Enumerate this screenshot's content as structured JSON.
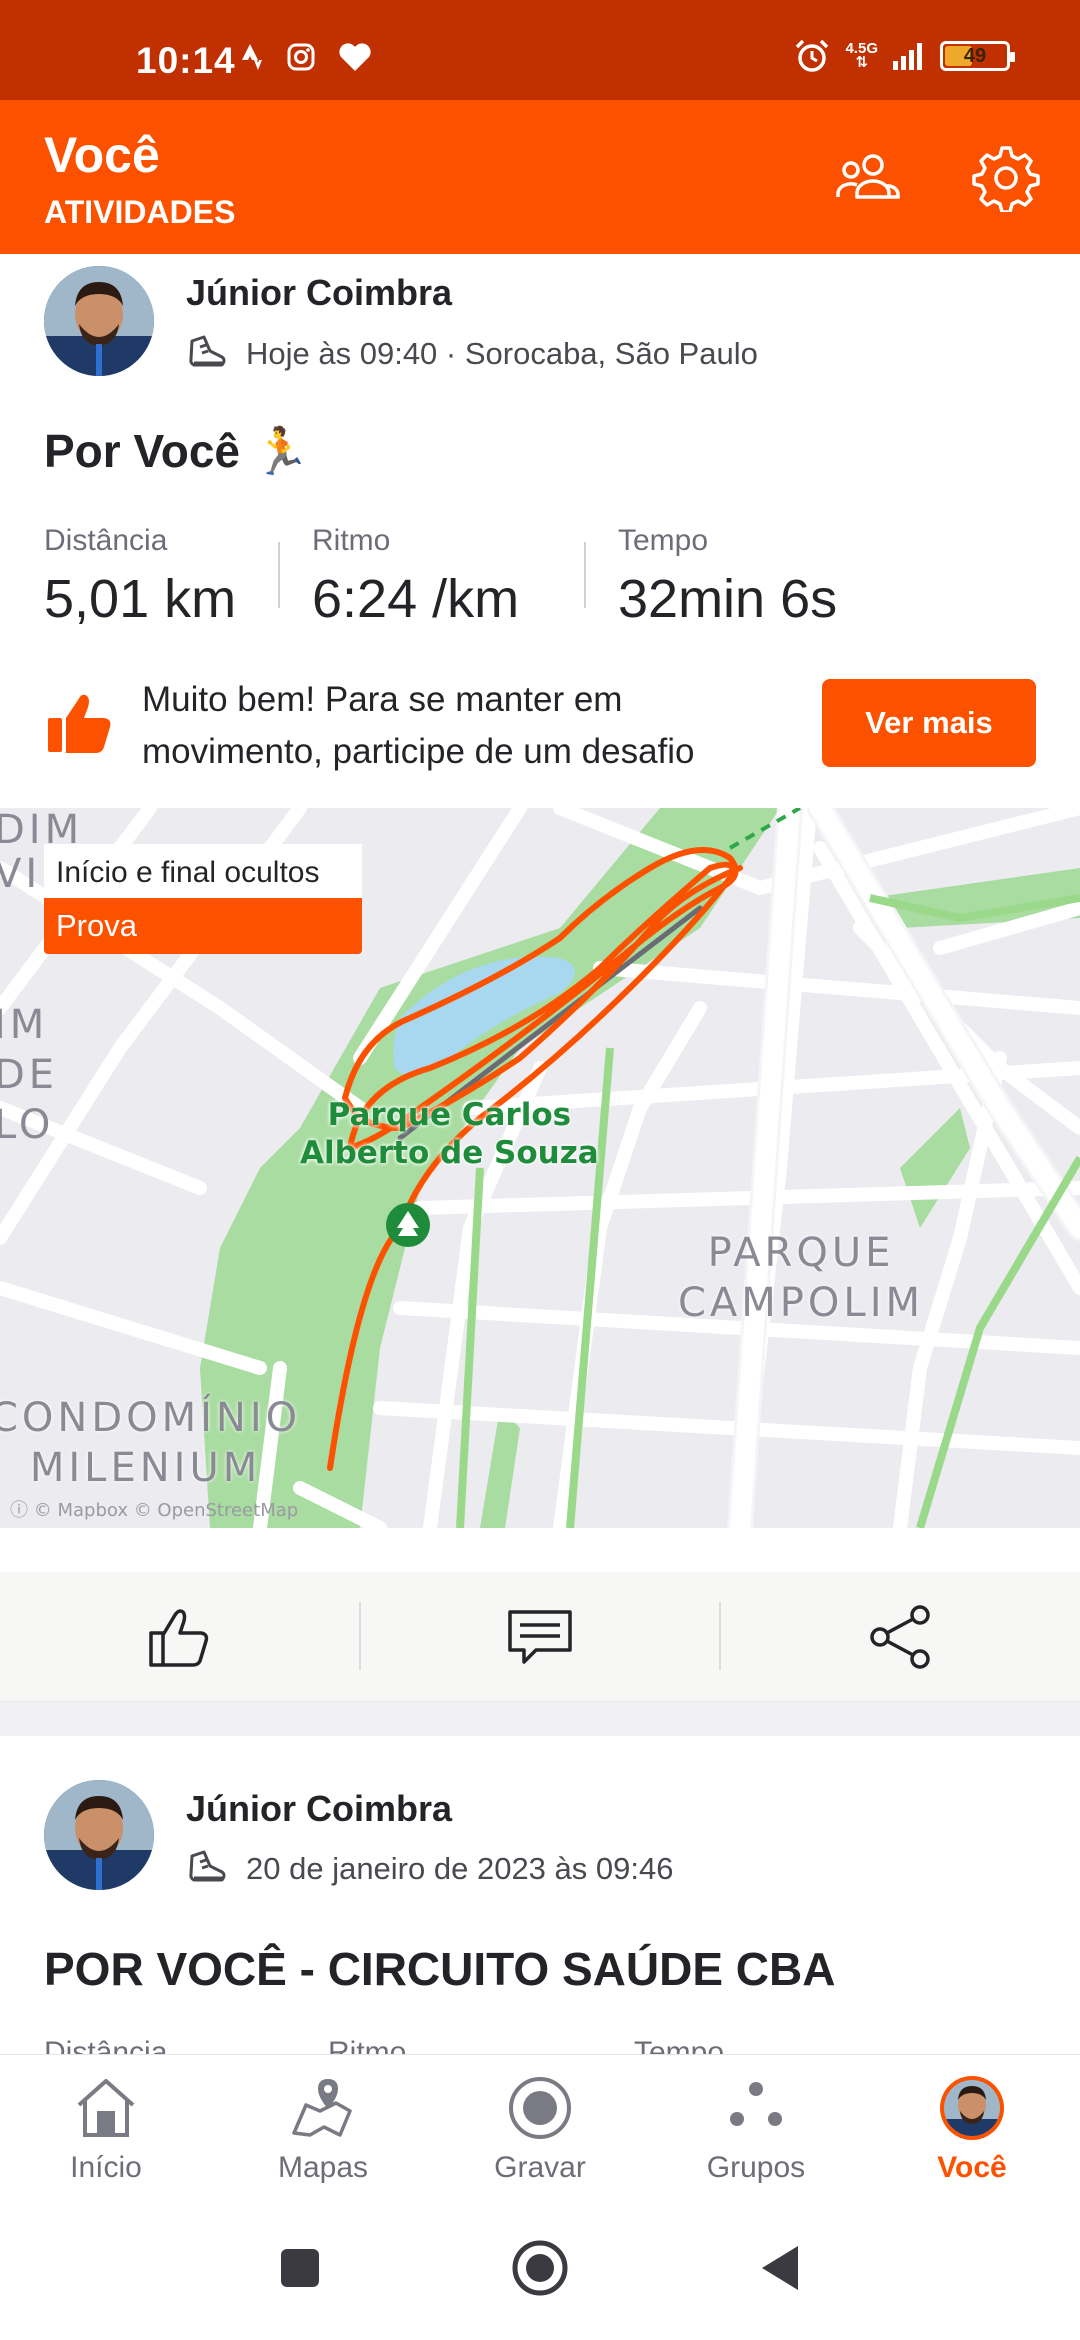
{
  "status_bar": {
    "time": "10:14",
    "network": "4.5G",
    "battery": "49",
    "battery_level": 0.49
  },
  "header": {
    "title": "Você",
    "subtitle": "ATIVIDADES"
  },
  "activity1": {
    "athlete": "Júnior Coimbra",
    "meta": "Hoje às 09:40 · Sorocaba, São Paulo",
    "title": "Por Você 🏃",
    "stats": [
      {
        "label": "Distância",
        "value": "5,01 km"
      },
      {
        "label": "Ritmo",
        "value": "6:24 /km"
      },
      {
        "label": "Tempo",
        "value": "32min 6s"
      }
    ],
    "suggestion": "Muito bem! Para se manter em movimento, participe de um desafio",
    "cta": "Ver mais"
  },
  "map": {
    "hidden_note": "Início e final ocultos",
    "tag": "Prova",
    "labels": {
      "park": "Parque Carlos Alberto de Souza",
      "park_l1": "Parque Carlos",
      "park_l2": "Alberto de Souza",
      "district1_l1": "PARQUE",
      "district1_l2": "CAMPOLIM",
      "district2_l1": "CONDOMÍNIO",
      "district2_l2": "MILENIUM",
      "left_a": "DIM",
      "left_b": "VI",
      "left_c": "IM",
      "left_d": "DE",
      "left_e": "LO"
    },
    "attribution": "© Mapbox © OpenStreetMap",
    "colors": {
      "route": "#fc5200",
      "park": "#a8dca0",
      "water": "#a8d8f0"
    }
  },
  "actions": {
    "like": "thumbs-up-icon",
    "comment": "comment-icon",
    "share": "share-icon"
  },
  "activity2": {
    "athlete": "Júnior Coimbra",
    "meta": "20 de janeiro de 2023 às 09:46",
    "title": "POR VOCÊ - CIRCUITO SAÚDE CBA",
    "stat_labels": [
      "Distância",
      "Ritmo",
      "Tempo"
    ]
  },
  "nav": {
    "items": [
      {
        "label": "Início",
        "icon": "home-icon"
      },
      {
        "label": "Mapas",
        "icon": "maps-icon"
      },
      {
        "label": "Gravar",
        "icon": "record-icon"
      },
      {
        "label": "Grupos",
        "icon": "groups-icon"
      },
      {
        "label": "Você",
        "icon": "avatar",
        "active": true
      }
    ]
  },
  "colors": {
    "brand": "#fc5200",
    "status_bar": "#c03000"
  }
}
